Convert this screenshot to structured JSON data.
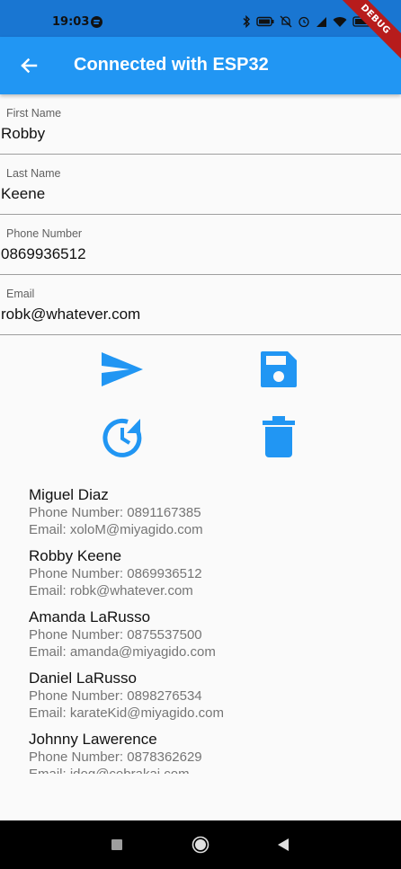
{
  "status_bar": {
    "time": "19:03",
    "icons": [
      "spotify-icon",
      "bluetooth-icon",
      "battery-saver-icon",
      "dnd-icon",
      "alarm-icon",
      "signal-icon",
      "wifi-icon",
      "battery-icon"
    ]
  },
  "debug_banner": "DEBUG",
  "app_bar": {
    "title": "Connected with ESP32",
    "back_icon": "arrow-back-icon",
    "color": "#2196f3"
  },
  "form": {
    "first_name": {
      "label": "First Name",
      "value": "Robby"
    },
    "last_name": {
      "label": "Last Name",
      "value": "Keene"
    },
    "phone_number": {
      "label": "Phone Number",
      "value": "0869936512"
    },
    "email": {
      "label": "Email",
      "value": "robk@whatever.com"
    }
  },
  "actions": {
    "send_icon": "send-icon",
    "save_icon": "save-icon",
    "history_icon": "history-icon",
    "delete_icon": "delete-icon",
    "color": "#2196f3"
  },
  "contacts": [
    {
      "name": "Miguel Diaz",
      "phone": "Phone Number: 0891167385",
      "email": "Email: xoloM@miyagido.com"
    },
    {
      "name": "Robby Keene",
      "phone": "Phone Number: 0869936512",
      "email": "Email: robk@whatever.com"
    },
    {
      "name": "Amanda LaRusso",
      "phone": "Phone Number: 0875537500",
      "email": "Email: amanda@miyagido.com"
    },
    {
      "name": "Daniel LaRusso",
      "phone": "Phone Number: 0898276534",
      "email": "Email: karateKid@miyagido.com"
    },
    {
      "name": "Johnny Lawerence",
      "phone": "Phone Number: 0878362629",
      "email": "Email: jdog@cobrakai.com"
    }
  ],
  "nav_bar": {
    "icons": [
      "recents-icon",
      "home-icon",
      "back-icon"
    ]
  }
}
